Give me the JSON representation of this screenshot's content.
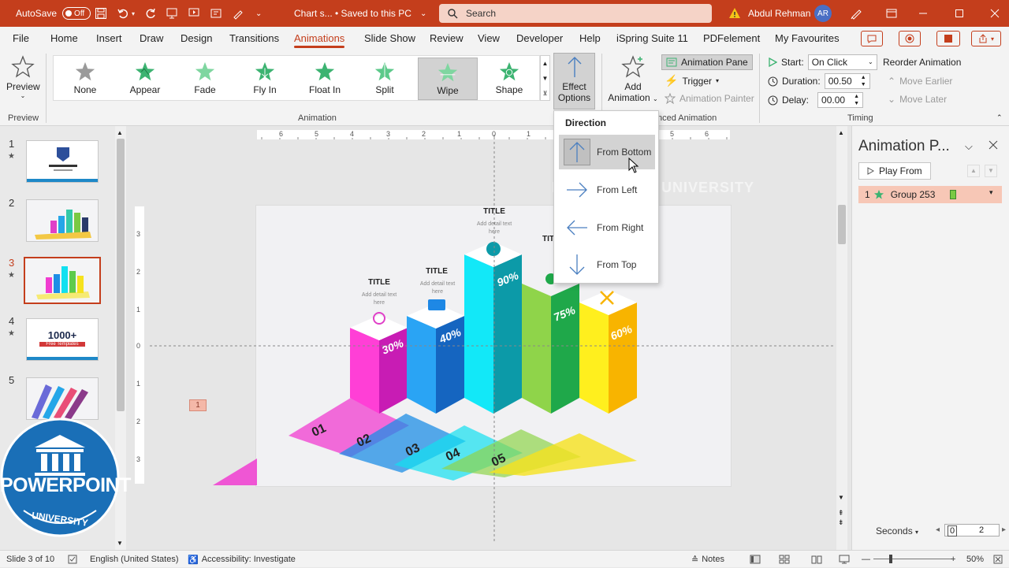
{
  "titlebar": {
    "autosave_label": "AutoSave",
    "autosave_state": "Off",
    "doc_title": "Chart s... • Saved to this PC",
    "search_placeholder": "Search",
    "user_name": "Abdul Rehman",
    "user_initials": "AR"
  },
  "menu": [
    "File",
    "Home",
    "Insert",
    "Draw",
    "Design",
    "Transitions",
    "Animations",
    "Slide Show",
    "Review",
    "View",
    "Developer",
    "Help",
    "iSpring Suite 11",
    "PDFelement",
    "My Favourites"
  ],
  "ribbon": {
    "preview_label": "Preview",
    "preview_group": "Preview",
    "animation_group": "Animation",
    "advanced_group": "nced Animation",
    "timing_group": "Timing",
    "animations": [
      "None",
      "Appear",
      "Fade",
      "Fly In",
      "Float In",
      "Split",
      "Wipe",
      "Shape"
    ],
    "selected_animation": "Wipe",
    "effect_options_line1": "Effect",
    "effect_options_line2": "Options",
    "add_animation_line1": "Add",
    "add_animation_line2": "Animation",
    "animation_pane": "Animation Pane",
    "trigger": "Trigger",
    "animation_painter": "Animation Painter",
    "start_label": "Start:",
    "start_value": "On Click",
    "duration_label": "Duration:",
    "duration_value": "00.50",
    "delay_label": "Delay:",
    "delay_value": "00.00",
    "reorder": "Reorder Animation",
    "move_earlier": "Move Earlier",
    "move_later": "Move Later"
  },
  "direction_menu": {
    "heading": "Direction",
    "items": [
      "From Bottom",
      "From Left",
      "From Right",
      "From Top"
    ],
    "highlighted": "From Bottom"
  },
  "slides": {
    "numbers": [
      "1",
      "2",
      "3",
      "4",
      "5"
    ],
    "thumb4_text": "1000+",
    "thumb4_sub": "Free Templates"
  },
  "slide_content": {
    "titles": [
      "TITLE",
      "TITLE",
      "TITLE",
      "TIT"
    ],
    "detail": [
      "Add detail text",
      "here"
    ],
    "percents": [
      "30%",
      "40%",
      "90%",
      "75%",
      "60%"
    ],
    "steps": [
      "01",
      "02",
      "03",
      "04",
      "05"
    ],
    "anim_tag": "1"
  },
  "ruler": {
    "h_ticks": [
      "6",
      "5",
      "4",
      "3",
      "2",
      "1",
      "0",
      "1",
      "2",
      "3",
      "4",
      "5",
      "6"
    ],
    "v_ticks": [
      "3",
      "2",
      "1",
      "0",
      "1",
      "2",
      "3"
    ]
  },
  "anim_pane": {
    "title": "Animation P...",
    "play_from": "Play From",
    "item_index": "1",
    "item_name": "Group 253",
    "seconds": "Seconds",
    "timeline_start": "0",
    "timeline_end": "2"
  },
  "watermark": "POWERPOINT UNIVERSITY",
  "logo": {
    "line1": "POWERPOINT",
    "line2": "UNIVERSITY"
  },
  "status": {
    "slide_info": "Slide 3 of 10",
    "language": "English (United States)",
    "accessibility": "Accessibility: Investigate",
    "notes": "Notes",
    "zoom": "50%"
  },
  "colors": {
    "accent": "#c43e1c",
    "star_green": "#3cb371"
  }
}
